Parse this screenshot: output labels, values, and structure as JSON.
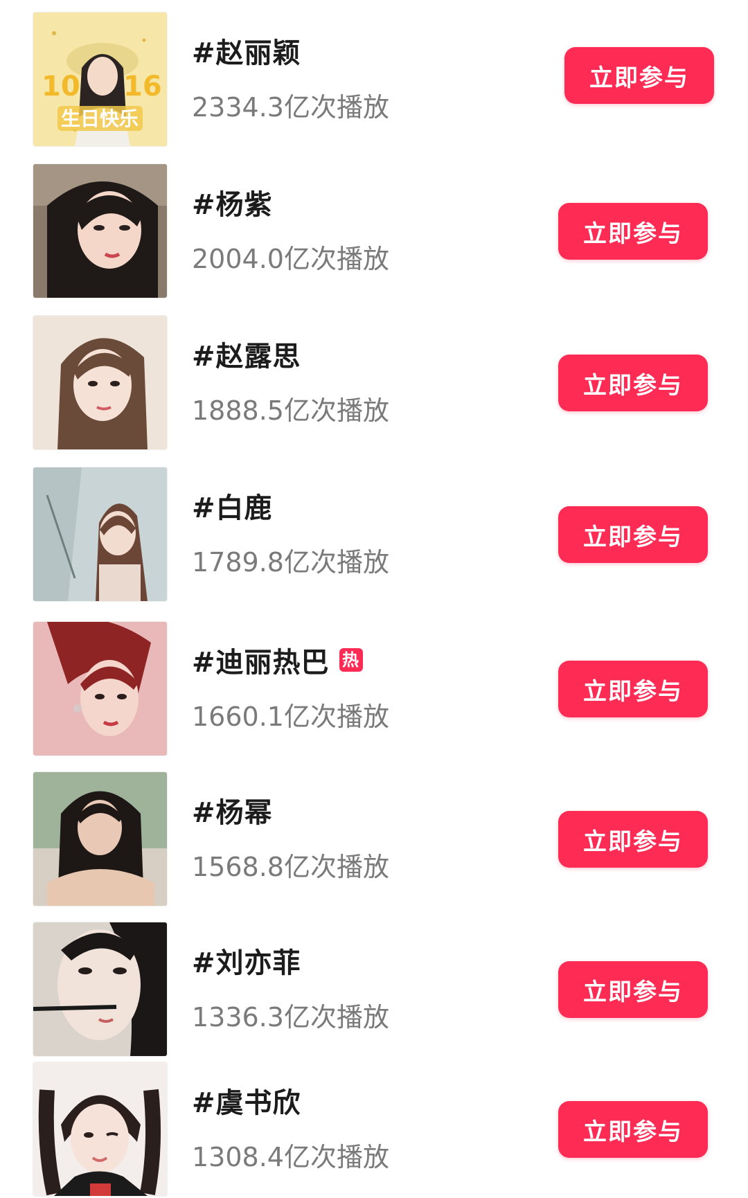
{
  "colors": {
    "accent": "#fe2c55",
    "title_text": "#1c1c1c",
    "subtitle_text": "#7a7a7a"
  },
  "items": [
    {
      "title": "#赵丽颖",
      "plays": "2334.3亿次播放",
      "button": "立即参与",
      "hot": false
    },
    {
      "title": "#杨紫",
      "plays": "2004.0亿次播放",
      "button": "立即参与",
      "hot": false
    },
    {
      "title": "#赵露思",
      "plays": "1888.5亿次播放",
      "button": "立即参与",
      "hot": false
    },
    {
      "title": "#白鹿",
      "plays": "1789.8亿次播放",
      "button": "立即参与",
      "hot": false
    },
    {
      "title": "#迪丽热巴",
      "plays": "1660.1亿次播放",
      "button": "立即参与",
      "hot": true,
      "badge": "热"
    },
    {
      "title": "#杨幂",
      "plays": "1568.8亿次播放",
      "button": "立即参与",
      "hot": false
    },
    {
      "title": "#刘亦菲",
      "plays": "1336.3亿次播放",
      "button": "立即参与",
      "hot": false
    },
    {
      "title": "#虞书欣",
      "plays": "1308.4亿次播放",
      "button": "立即参与",
      "hot": false
    }
  ],
  "thumb_banner": {
    "numbers": "10 16",
    "text": "生日快乐"
  }
}
